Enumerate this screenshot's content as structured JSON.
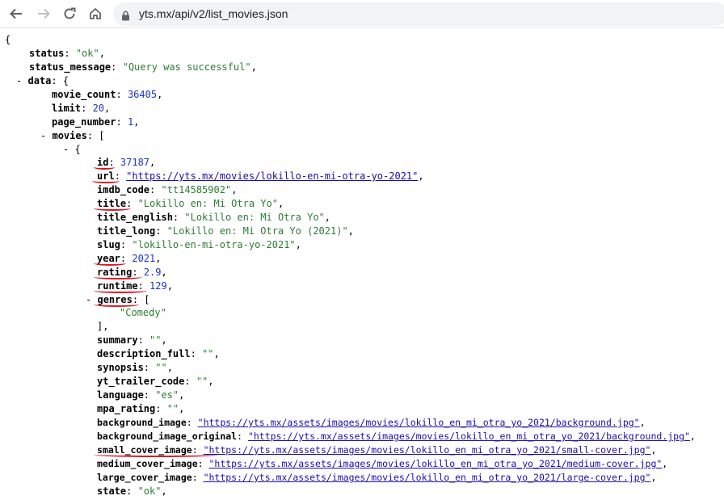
{
  "browser": {
    "url": "yts.mx/api/v2/list_movies.json"
  },
  "json": {
    "open_brace": "{",
    "status": {
      "key": "status",
      "value": "\"ok\""
    },
    "status_message": {
      "key": "status_message",
      "value": "\"Query was successful\""
    },
    "data": {
      "toggle": "-",
      "key": "data",
      "open": "{"
    },
    "movie_count": {
      "key": "movie_count",
      "value": "36405"
    },
    "limit": {
      "key": "limit",
      "value": "20"
    },
    "page_number": {
      "key": "page_number",
      "value": "1"
    },
    "movies": {
      "toggle": "-",
      "key": "movies",
      "open": "["
    },
    "item_open": {
      "toggle": "-",
      "open": "{"
    },
    "id": {
      "key": "id",
      "value": "37187"
    },
    "url": {
      "key": "url",
      "value": "\"https://yts.mx/movies/lokillo-en-mi-otra-yo-2021\""
    },
    "imdb_code": {
      "key": "imdb_code",
      "value": "\"tt14585902\""
    },
    "title": {
      "key": "title",
      "value": "\"Lokillo en: Mi Otra Yo\""
    },
    "title_english": {
      "key": "title_english",
      "value": "\"Lokillo en: Mi Otra Yo\""
    },
    "title_long": {
      "key": "title_long",
      "value": "\"Lokillo en: Mi Otra Yo (2021)\""
    },
    "slug": {
      "key": "slug",
      "value": "\"lokillo-en-mi-otra-yo-2021\""
    },
    "year": {
      "key": "year",
      "value": "2021"
    },
    "rating": {
      "key": "rating",
      "value": "2.9"
    },
    "runtime": {
      "key": "runtime",
      "value": "129"
    },
    "genres": {
      "toggle": "-",
      "key": "genres",
      "open": "[",
      "items": [
        "\"Comedy\""
      ],
      "close": "],"
    },
    "summary": {
      "key": "summary",
      "value": "\"\""
    },
    "description_full": {
      "key": "description_full",
      "value": "\"\""
    },
    "synopsis": {
      "key": "synopsis",
      "value": "\"\""
    },
    "yt_trailer_code": {
      "key": "yt_trailer_code",
      "value": "\"\""
    },
    "language": {
      "key": "language",
      "value": "\"es\""
    },
    "mpa_rating": {
      "key": "mpa_rating",
      "value": "\"\""
    },
    "background_image": {
      "key": "background_image",
      "value": "\"https://yts.mx/assets/images/movies/lokillo_en_mi_otra_yo_2021/background.jpg\""
    },
    "background_image_original": {
      "key": "background_image_original",
      "value": "\"https://yts.mx/assets/images/movies/lokillo_en_mi_otra_yo_2021/background.jpg\""
    },
    "small_cover_image": {
      "key": "small_cover_image",
      "value": "\"https://yts.mx/assets/images/movies/lokillo_en_mi_otra_yo_2021/small-cover.jpg\""
    },
    "medium_cover_image": {
      "key": "medium_cover_image",
      "value": "\"https://yts.mx/assets/images/movies/lokillo_en_mi_otra_yo_2021/medium-cover.jpg\""
    },
    "large_cover_image": {
      "key": "large_cover_image",
      "value": "\"https://yts.mx/assets/images/movies/lokillo_en_mi_otra_yo_2021/large-cover.jpg\""
    },
    "state": {
      "key": "state",
      "value": "\"ok\""
    }
  },
  "colors": {
    "string": "#2e7d32",
    "number": "#1c34c7",
    "link": "#1a0dab",
    "annotation": "#e0141e"
  },
  "icons": [
    "back-arrow-icon",
    "forward-arrow-icon",
    "reload-icon",
    "home-icon",
    "lock-icon"
  ]
}
